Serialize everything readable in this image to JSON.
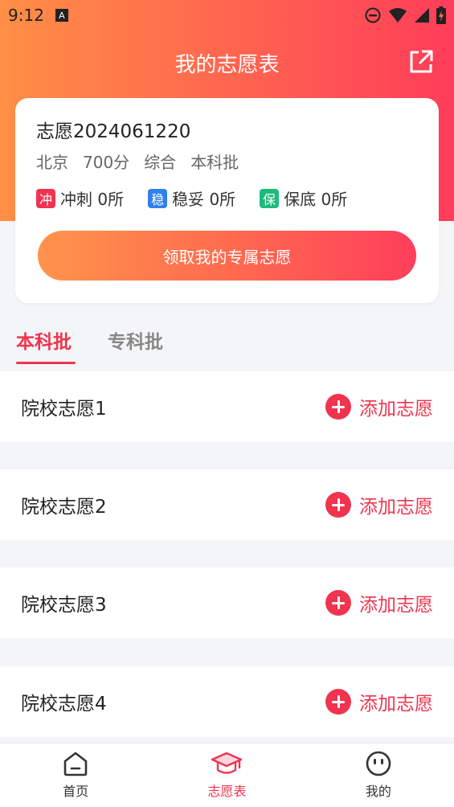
{
  "status_bar": {
    "time": "9:12",
    "sim_label": "A"
  },
  "header": {
    "title": "我的志愿表"
  },
  "card": {
    "name": "志愿2024061220",
    "meta": [
      "北京",
      "700分",
      "综合",
      "本科批"
    ],
    "levels": [
      {
        "tag": "冲",
        "label": "冲刺 0所",
        "color": "#f0334f"
      },
      {
        "tag": "稳",
        "label": "稳妥 0所",
        "color": "#2f80ed"
      },
      {
        "tag": "保",
        "label": "保底 0所",
        "color": "#1dbb7a"
      }
    ],
    "cta_label": "领取我的专属志愿"
  },
  "tabs": [
    {
      "label": "本科批",
      "active": true
    },
    {
      "label": "专科批",
      "active": false
    }
  ],
  "rows": [
    {
      "label": "院校志愿1",
      "action": "添加志愿"
    },
    {
      "label": "院校志愿2",
      "action": "添加志愿"
    },
    {
      "label": "院校志愿3",
      "action": "添加志愿"
    },
    {
      "label": "院校志愿4",
      "action": "添加志愿"
    }
  ],
  "bottom_nav": [
    {
      "label": "首页",
      "icon": "home-icon"
    },
    {
      "label": "志愿表",
      "icon": "graduation-cap-icon",
      "active": true
    },
    {
      "label": "我的",
      "icon": "smiley-icon"
    }
  ],
  "colors": {
    "accent": "#f0334f",
    "gradient_start": "#ff8f45",
    "gradient_end": "#ff3d5a"
  }
}
